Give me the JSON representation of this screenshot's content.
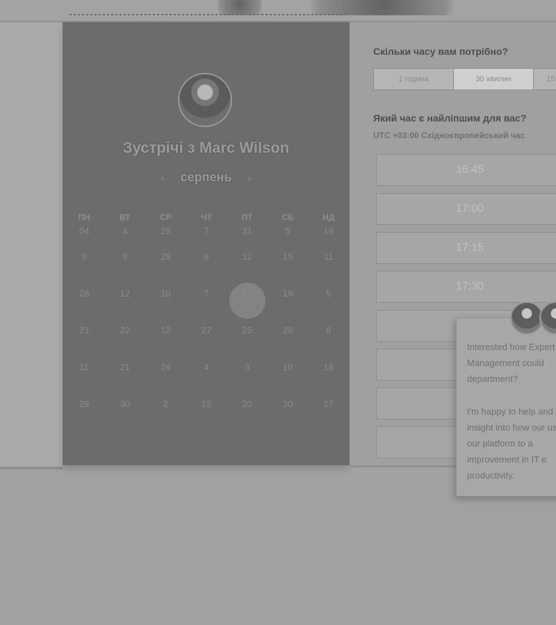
{
  "calendar": {
    "host_title": "Зустрічі з Marc Wilson",
    "month": "серпень",
    "prev_icon": "chevron-left-icon",
    "next_icon": "chevron-right-icon",
    "weekdays": [
      "ПН",
      "ВТ",
      "СР",
      "ЧТ",
      "ПТ",
      "СБ",
      "НД"
    ],
    "first_row": [
      "04",
      "4",
      "28",
      "7",
      "31",
      "5",
      "19"
    ],
    "weeks": [
      [
        "9",
        "9",
        "29",
        "6",
        "12",
        "15",
        "11"
      ],
      [
        "28",
        "12",
        "10",
        "7",
        "17",
        "19",
        "5"
      ],
      [
        "21",
        "22",
        "12",
        "27",
        "25",
        "28",
        "8"
      ],
      [
        "11",
        "21",
        "24",
        "4",
        "3",
        "10",
        "16"
      ],
      [
        "26",
        "30",
        "2",
        "12",
        "20",
        "30",
        "27"
      ]
    ],
    "selected_day": "17"
  },
  "scheduler": {
    "duration_question": "Скільки часу вам потрібно?",
    "durations": [
      "1 година",
      "30 хвилин",
      "15"
    ],
    "active_duration": "30 хвилин",
    "time_question": "Який час є найліпшим для вас?",
    "timezone": "UTC +03:00 Східноєвропейський час",
    "slots": [
      "16:45",
      "17:00",
      "17:15",
      "17:30",
      "",
      "",
      "",
      ""
    ]
  },
  "chat": {
    "message_1": "Interested how Expert Management could department?",
    "message_2": "I'm happy to help and insight into how our use our platform to a improvement in IT e productivity."
  }
}
